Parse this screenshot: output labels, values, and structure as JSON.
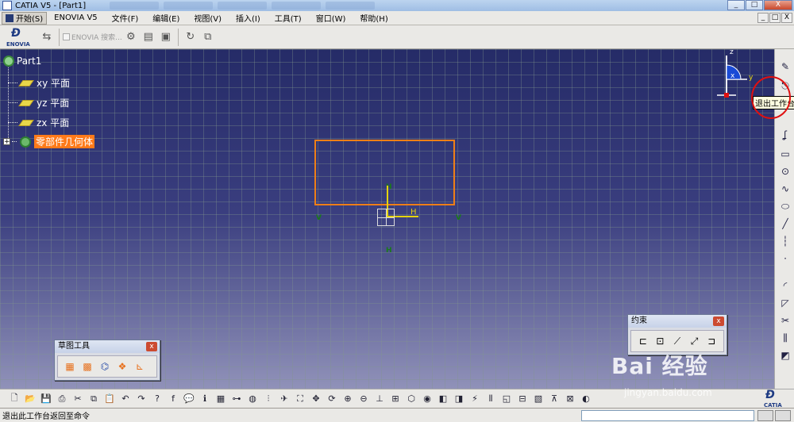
{
  "window": {
    "title": "CATIA V5 - [Part1]",
    "min": "_",
    "max": "□",
    "close": "X"
  },
  "menubar": {
    "start": "开始(S)",
    "items": [
      "ENOVIA V5",
      "文件(F)",
      "编辑(E)",
      "视图(V)",
      "插入(I)",
      "工具(T)",
      "窗口(W)",
      "帮助(H)"
    ]
  },
  "top_toolbar": {
    "search_label": "ENOVIA 搜索..."
  },
  "brand": {
    "enovia": "ENOVIA",
    "catia": "CATIA"
  },
  "tree": {
    "root": "Part1",
    "planes": [
      "xy 平面",
      "yz 平面",
      "zx 平面"
    ],
    "body": "零部件几何体",
    "expand": "+"
  },
  "sketch": {
    "constraint_v": "V",
    "constraint_h": "H",
    "axis_label": "H"
  },
  "compass": {
    "z": "z",
    "x": "x",
    "y": "y"
  },
  "tooltip": "退出工作台",
  "palettes": {
    "sketch_tools": {
      "title": "草图工具",
      "close": "x"
    },
    "constraints": {
      "title": "约束",
      "close": "x"
    }
  },
  "status": {
    "message": "退出此工作台返回至命令"
  },
  "watermark": {
    "main": "Bai 经验",
    "sub": "jingyan.baidu.com"
  },
  "colors": {
    "canvas_top": "#252b67",
    "canvas_bottom": "#9b9cc0",
    "sketch_outline": "#ee7f17",
    "selection": "#ff7a1a",
    "annotation_circle": "#e01010"
  }
}
